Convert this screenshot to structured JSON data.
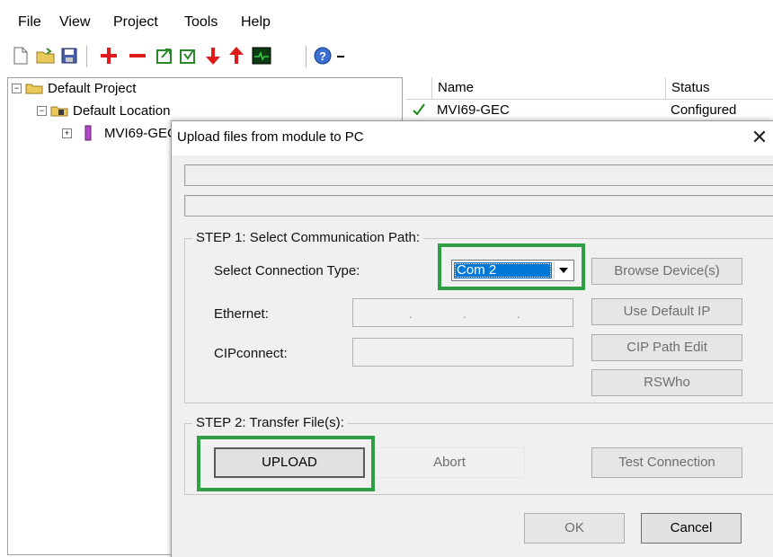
{
  "menu": [
    "File",
    "View",
    "Project",
    "Tools",
    "Help"
  ],
  "toolbar_icons": [
    "new-file-icon",
    "open-folder-icon",
    "save-icon",
    "add-icon",
    "remove-icon",
    "export-icon",
    "import-icon",
    "move-down-icon",
    "move-up-icon",
    "monitor-icon",
    "help-icon"
  ],
  "tree": {
    "project": "Default Project",
    "location": "Default Location",
    "module": "MVI69-GEC"
  },
  "list": {
    "columns": [
      "Name",
      "Status"
    ],
    "rows": [
      {
        "name": "MVI69-GEC",
        "status": "Configured"
      }
    ]
  },
  "dialog": {
    "title": "Upload files from module to PC",
    "close": "✕",
    "step1": {
      "legend": "STEP 1: Select Communication Path:",
      "connection_label": "Select Connection Type:",
      "connection_value": "Com 2",
      "ethernet_label": "Ethernet:",
      "ip_dots": [
        ".",
        ".",
        "."
      ],
      "cip_label": "CIPconnect:",
      "browse_button": "Browse Device(s)",
      "default_ip_button": "Use Default IP",
      "cip_path_button": "CIP Path Edit",
      "rswho_button": "RSWho"
    },
    "step2": {
      "legend": "STEP 2: Transfer File(s):",
      "upload_button": "UPLOAD",
      "abort_button": "Abort",
      "test_button": "Test Connection"
    },
    "ok_button": "OK",
    "cancel_button": "Cancel"
  },
  "colors": {
    "highlight": "#2ea043",
    "selection": "#0078d7",
    "dialog_bg": "#f0f0f0"
  }
}
